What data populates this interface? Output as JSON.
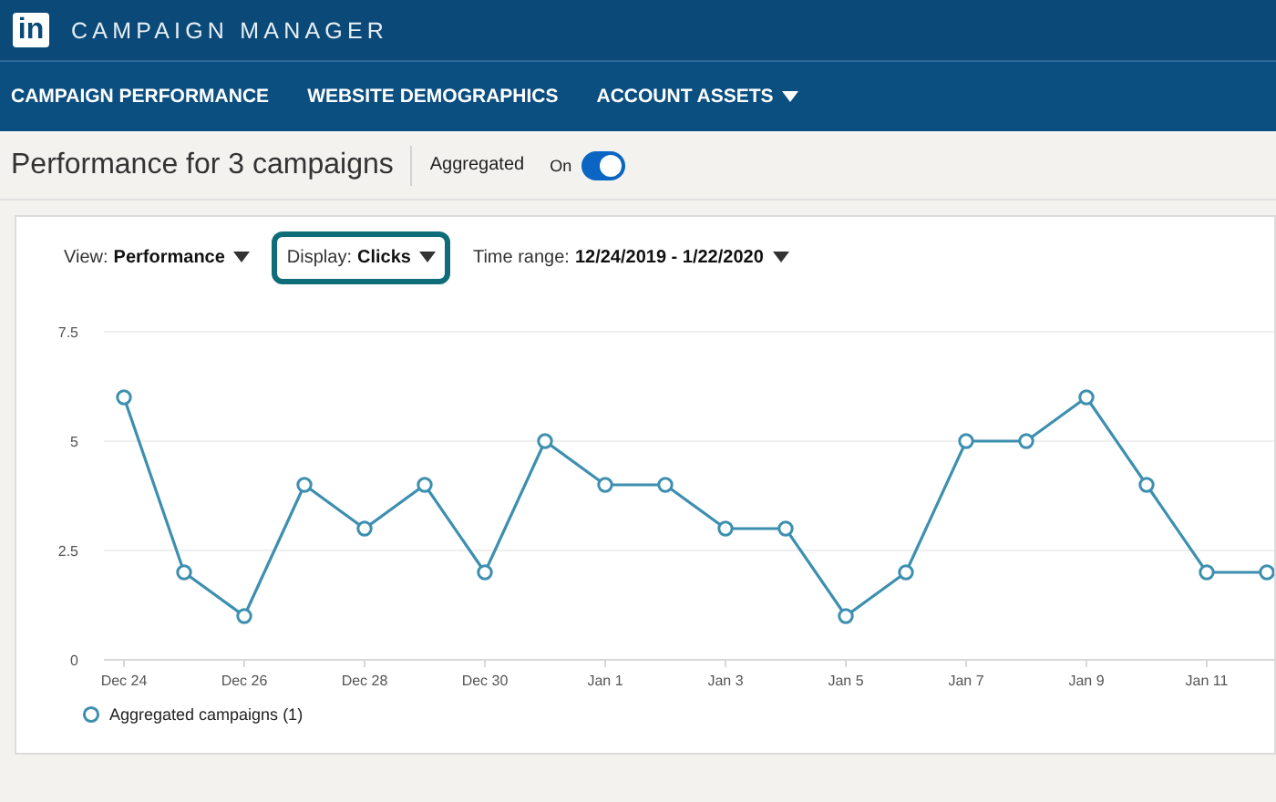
{
  "header": {
    "logo": "in",
    "title": "CAMPAIGN MANAGER"
  },
  "nav": [
    {
      "label": "CAMPAIGN PERFORMANCE",
      "has_menu": false
    },
    {
      "label": "WEBSITE DEMOGRAPHICS",
      "has_menu": false
    },
    {
      "label": "ACCOUNT ASSETS",
      "has_menu": true
    }
  ],
  "summary": {
    "title": "Performance for 3 campaigns",
    "toggle_label": "Aggregated",
    "toggle_state_text": "On",
    "toggle_on": true
  },
  "controls": [
    {
      "label": "View:",
      "value": "Performance",
      "highlighted": false
    },
    {
      "label": "Display:",
      "value": "Clicks",
      "highlighted": true
    },
    {
      "label": "Time range:",
      "value": "12/24/2019 - 1/22/2020",
      "highlighted": false
    }
  ],
  "chart": {
    "chart_data": {
      "type": "line",
      "categories": [
        "Dec 24",
        null,
        "Dec 26",
        null,
        "Dec 28",
        null,
        "Dec 30",
        null,
        "Jan 1",
        null,
        "Jan 3",
        null,
        "Jan 5",
        null,
        "Jan 7",
        null,
        "Jan 9",
        null,
        "Jan 11",
        null
      ],
      "series": [
        {
          "name": "Aggregated campaigns (1)",
          "color": "#3d8fb0",
          "marker": "circle",
          "values": [
            6,
            2,
            1,
            4,
            3,
            4,
            2,
            5,
            4,
            4,
            3,
            3,
            1,
            2,
            5,
            5,
            6,
            4,
            2,
            2
          ]
        }
      ],
      "ylim": [
        0,
        7.5
      ],
      "yticks": [
        {
          "value": 0,
          "label": "0"
        },
        {
          "value": 2.5,
          "label": "2.5"
        },
        {
          "value": 5,
          "label": "5"
        },
        {
          "value": 7.5,
          "label": "7.5"
        }
      ]
    }
  }
}
